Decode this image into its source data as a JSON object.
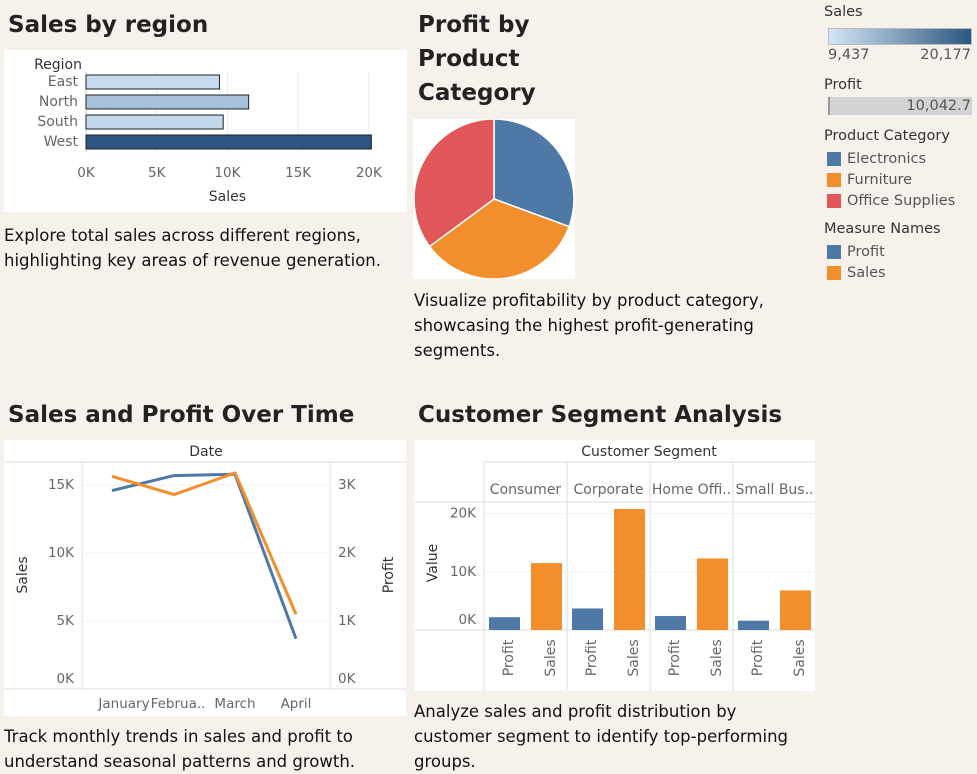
{
  "dashboard": {
    "region": {
      "title": "Sales by region",
      "description": [
        "Explore total sales across different regions,",
        "highlighting key areas of revenue generation."
      ]
    },
    "category": {
      "title": [
        "Profit by",
        "Product",
        "Category"
      ],
      "description": [
        "Visualize profitability by product category,",
        "showcasing the highest profit-generating",
        "segments."
      ]
    },
    "time": {
      "title": "Sales and Profit Over Time",
      "description": [
        "Track monthly trends in sales and profit to",
        "understand seasonal patterns and growth."
      ]
    },
    "segment": {
      "title": "Customer Segment Analysis",
      "description": [
        "Analyze sales and profit distribution by",
        "customer segment to identify top-performing",
        "groups."
      ]
    }
  },
  "legend": {
    "sales": {
      "label": "Sales",
      "min": "9,437",
      "max": "20,177"
    },
    "profit": {
      "label": "Profit",
      "value": "10,042.7"
    },
    "product_category": {
      "label": "Product Category",
      "items": [
        {
          "name": "Electronics",
          "color": "#4e79a7"
        },
        {
          "name": "Furniture",
          "color": "#f28e2b"
        },
        {
          "name": "Office Supplies",
          "color": "#e15759"
        }
      ]
    },
    "measure_names": {
      "label": "Measure Names",
      "items": [
        {
          "name": "Profit",
          "color": "#4e79a7"
        },
        {
          "name": "Sales",
          "color": "#f28e2b"
        }
      ]
    }
  },
  "chart_data": [
    {
      "type": "bar",
      "orientation": "horizontal",
      "title": "Sales by region",
      "category_header": "Region",
      "categories": [
        "East",
        "North",
        "South",
        "West"
      ],
      "values": [
        9437,
        11500,
        9700,
        20177
      ],
      "xlabel": "Sales",
      "xticks": [
        "0K",
        "5K",
        "10K",
        "15K",
        "20K"
      ],
      "xlim": [
        0,
        21000
      ],
      "color_scale": {
        "min_color": "#c6dbef",
        "max_color": "#2c5680"
      }
    },
    {
      "type": "pie",
      "title": "Profit by Product Category",
      "labels": [
        "Electronics",
        "Furniture",
        "Office Supplies"
      ],
      "values": [
        30.6,
        34.3,
        35.1
      ],
      "colors": [
        "#4e79a7",
        "#f28e2b",
        "#e15759"
      ]
    },
    {
      "type": "line",
      "title": "Sales and Profit Over Time",
      "header": "Date",
      "categories": [
        "January",
        "Februa..",
        "March",
        "April"
      ],
      "series": [
        {
          "name": "Sales",
          "axis": "left",
          "values": [
            14600,
            15700,
            15800,
            3700
          ],
          "color": "#4e79a7"
        },
        {
          "name": "Profit",
          "axis": "right",
          "values": [
            3130,
            2860,
            3180,
            1100
          ],
          "color": "#f28e2b"
        }
      ],
      "ylabel_left": "Sales",
      "ylabel_right": "Profit",
      "yticks_left": [
        "0K",
        "5K",
        "10K",
        "15K"
      ],
      "yticks_right": [
        "0K",
        "1K",
        "2K",
        "3K"
      ],
      "ylim_left": [
        0,
        16700
      ],
      "ylim_right": [
        0,
        3340
      ]
    },
    {
      "type": "bar",
      "title": "Customer Segment Analysis",
      "header": "Customer Segment",
      "categories": [
        "Consumer",
        "Corporate",
        "Home Offi..",
        "Small Bus.."
      ],
      "measures": [
        "Profit",
        "Sales"
      ],
      "series": [
        {
          "name": "Profit",
          "values": [
            2200,
            3700,
            2400,
            1600
          ],
          "color": "#4e79a7"
        },
        {
          "name": "Sales",
          "values": [
            11500,
            20800,
            12300,
            6800
          ],
          "color": "#f28e2b"
        }
      ],
      "ylabel": "Value",
      "yticks": [
        "0K",
        "10K",
        "20K"
      ],
      "ylim": [
        0,
        22000
      ]
    }
  ]
}
